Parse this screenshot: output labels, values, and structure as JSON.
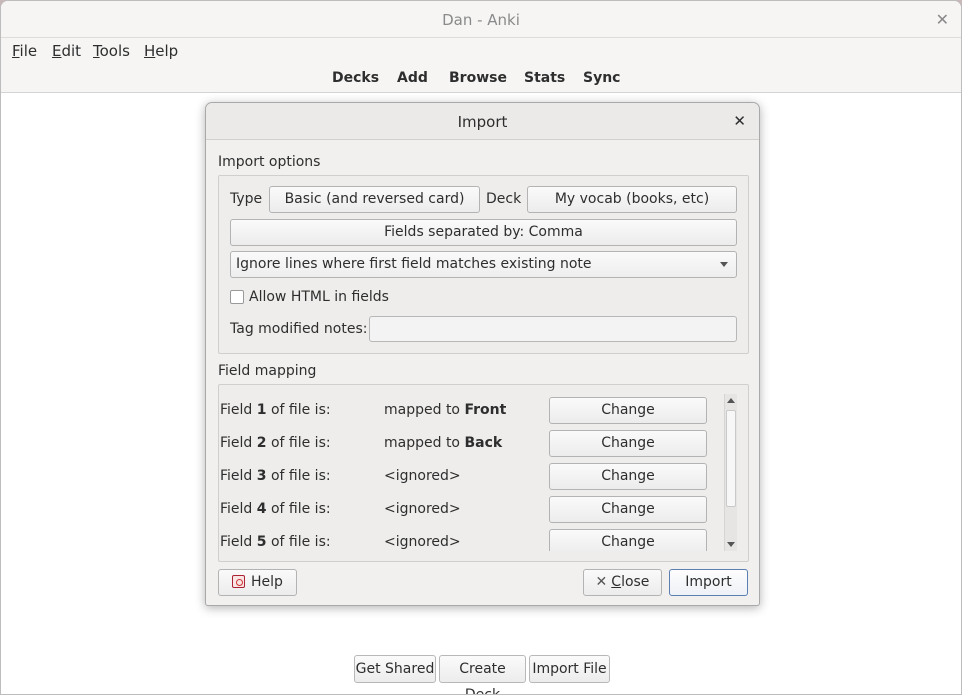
{
  "window": {
    "title": "Dan - Anki",
    "close_glyph": "✕"
  },
  "menubar": {
    "items": [
      {
        "label_prefix": "",
        "mnemonic": "F",
        "label_rest": "ile"
      },
      {
        "label_prefix": "",
        "mnemonic": "E",
        "label_rest": "dit"
      },
      {
        "label_prefix": "",
        "mnemonic": "T",
        "label_rest": "ools"
      },
      {
        "label_prefix": "",
        "mnemonic": "H",
        "label_rest": "elp"
      }
    ]
  },
  "toolbar": {
    "decks": "Decks",
    "add": "Add",
    "browse": "Browse",
    "stats": "Stats",
    "sync": "Sync"
  },
  "bottom_bar": {
    "get_shared": "Get Shared",
    "create_deck": "Create Deck",
    "import_file": "Import File"
  },
  "dialog": {
    "title": "Import",
    "close_glyph": "✕",
    "import_options_label": "Import options",
    "type_label": "Type",
    "type_value": "Basic (and reversed card)",
    "deck_label": "Deck",
    "deck_value": "My vocab (books, etc)",
    "fields_separated": "Fields separated by: Comma",
    "duplicate_mode": "Ignore lines where first field matches existing note",
    "allow_html_label": "Allow HTML in fields",
    "allow_html_checked": false,
    "tag_modified_label": "Tag modified notes:",
    "tag_modified_value": "",
    "field_mapping_label": "Field mapping",
    "mappings": [
      {
        "pre": "Field ",
        "num": "1",
        "post": " of file is:",
        "target_pre": "mapped to ",
        "target_bold": "Front",
        "change": "Change"
      },
      {
        "pre": "Field ",
        "num": "2",
        "post": " of file is:",
        "target_pre": "mapped to ",
        "target_bold": "Back",
        "change": "Change"
      },
      {
        "pre": "Field ",
        "num": "3",
        "post": " of file is:",
        "target_pre": "<ignored>",
        "target_bold": "",
        "change": "Change"
      },
      {
        "pre": "Field ",
        "num": "4",
        "post": " of file is:",
        "target_pre": "<ignored>",
        "target_bold": "",
        "change": "Change"
      },
      {
        "pre": "Field ",
        "num": "5",
        "post": " of file is:",
        "target_pre": "<ignored>",
        "target_bold": "",
        "change": "Change"
      }
    ],
    "help_button": "Help",
    "close_button_mnemonic": "C",
    "close_button_rest": "lose",
    "import_button": "Import"
  }
}
